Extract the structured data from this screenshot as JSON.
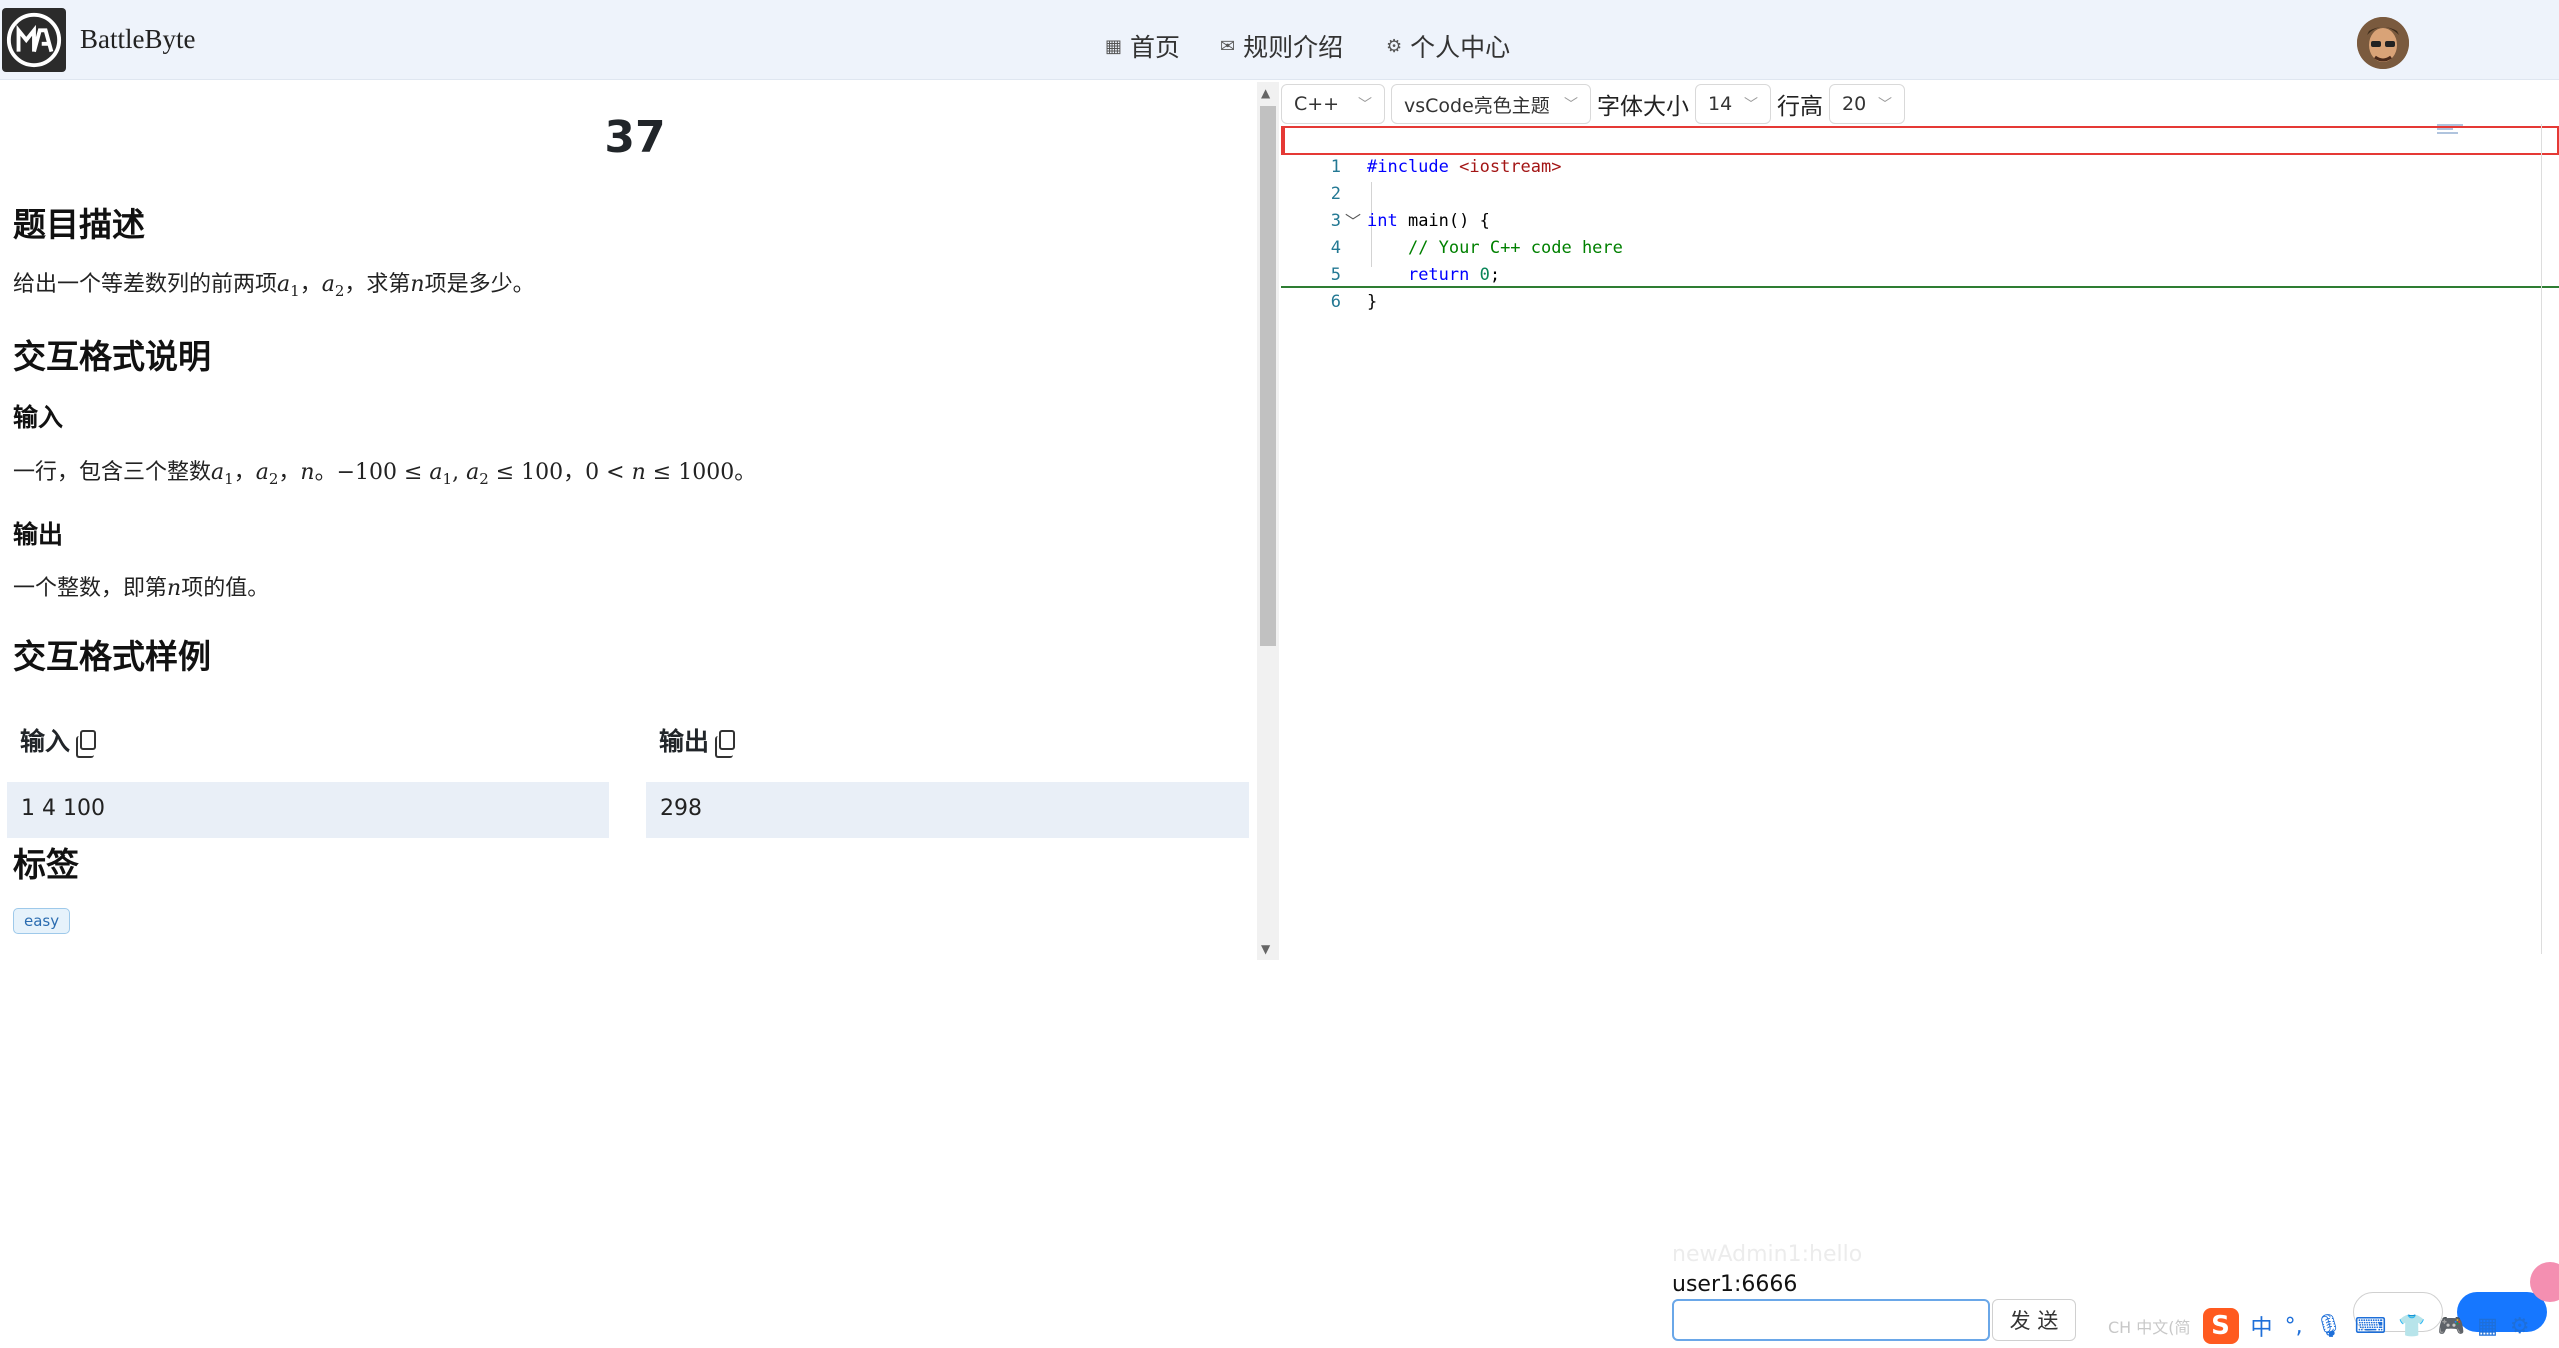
{
  "header": {
    "brand": "BattleByte",
    "nav": [
      {
        "label": "首页",
        "icon": "grid-icon"
      },
      {
        "label": "规则介绍",
        "icon": "mail-icon"
      },
      {
        "label": "个人中心",
        "icon": "gear-icon"
      }
    ]
  },
  "problem": {
    "title": "37",
    "description_heading": "题目描述",
    "description_pre": "给出一个等差数列的前两项",
    "description_mid": "，求第",
    "description_post": "项是多少。",
    "format_heading": "交互格式说明",
    "input_heading": "输入",
    "input_text_pre": "一行，包含三个整数",
    "output_heading": "输出",
    "output_text_pre": "一个整数，即第",
    "output_text_post": "项的值。",
    "samples_heading": "交互格式样例",
    "sample_input_label": "输入",
    "sample_output_label": "输出",
    "sample_input": "1 4 100",
    "sample_output": "298",
    "tags_heading": "标签",
    "tags": [
      "easy"
    ]
  },
  "editor": {
    "language": "C++",
    "theme": "vsCode亮色主题",
    "font_size_label": "字体大小",
    "font_size": "14",
    "line_height_label": "行高",
    "line_height": "20",
    "lines": [
      "#include <iostream>",
      "",
      "int main() {",
      "    // Your C++ code here",
      "    return 0;",
      "}"
    ]
  },
  "chat": {
    "faded_message": "newAdmin1:hello",
    "message": "user1:6666",
    "input_value": "",
    "send_label": "发 送"
  },
  "tray": {
    "ime_status": "CH 中文(简",
    "ime_mode": "中"
  },
  "colors": {
    "header_bg": "#eef3fb",
    "sample_bg": "#e9eff7",
    "keyword": "#0000ff",
    "comment": "#008000",
    "line_number": "#237893"
  }
}
